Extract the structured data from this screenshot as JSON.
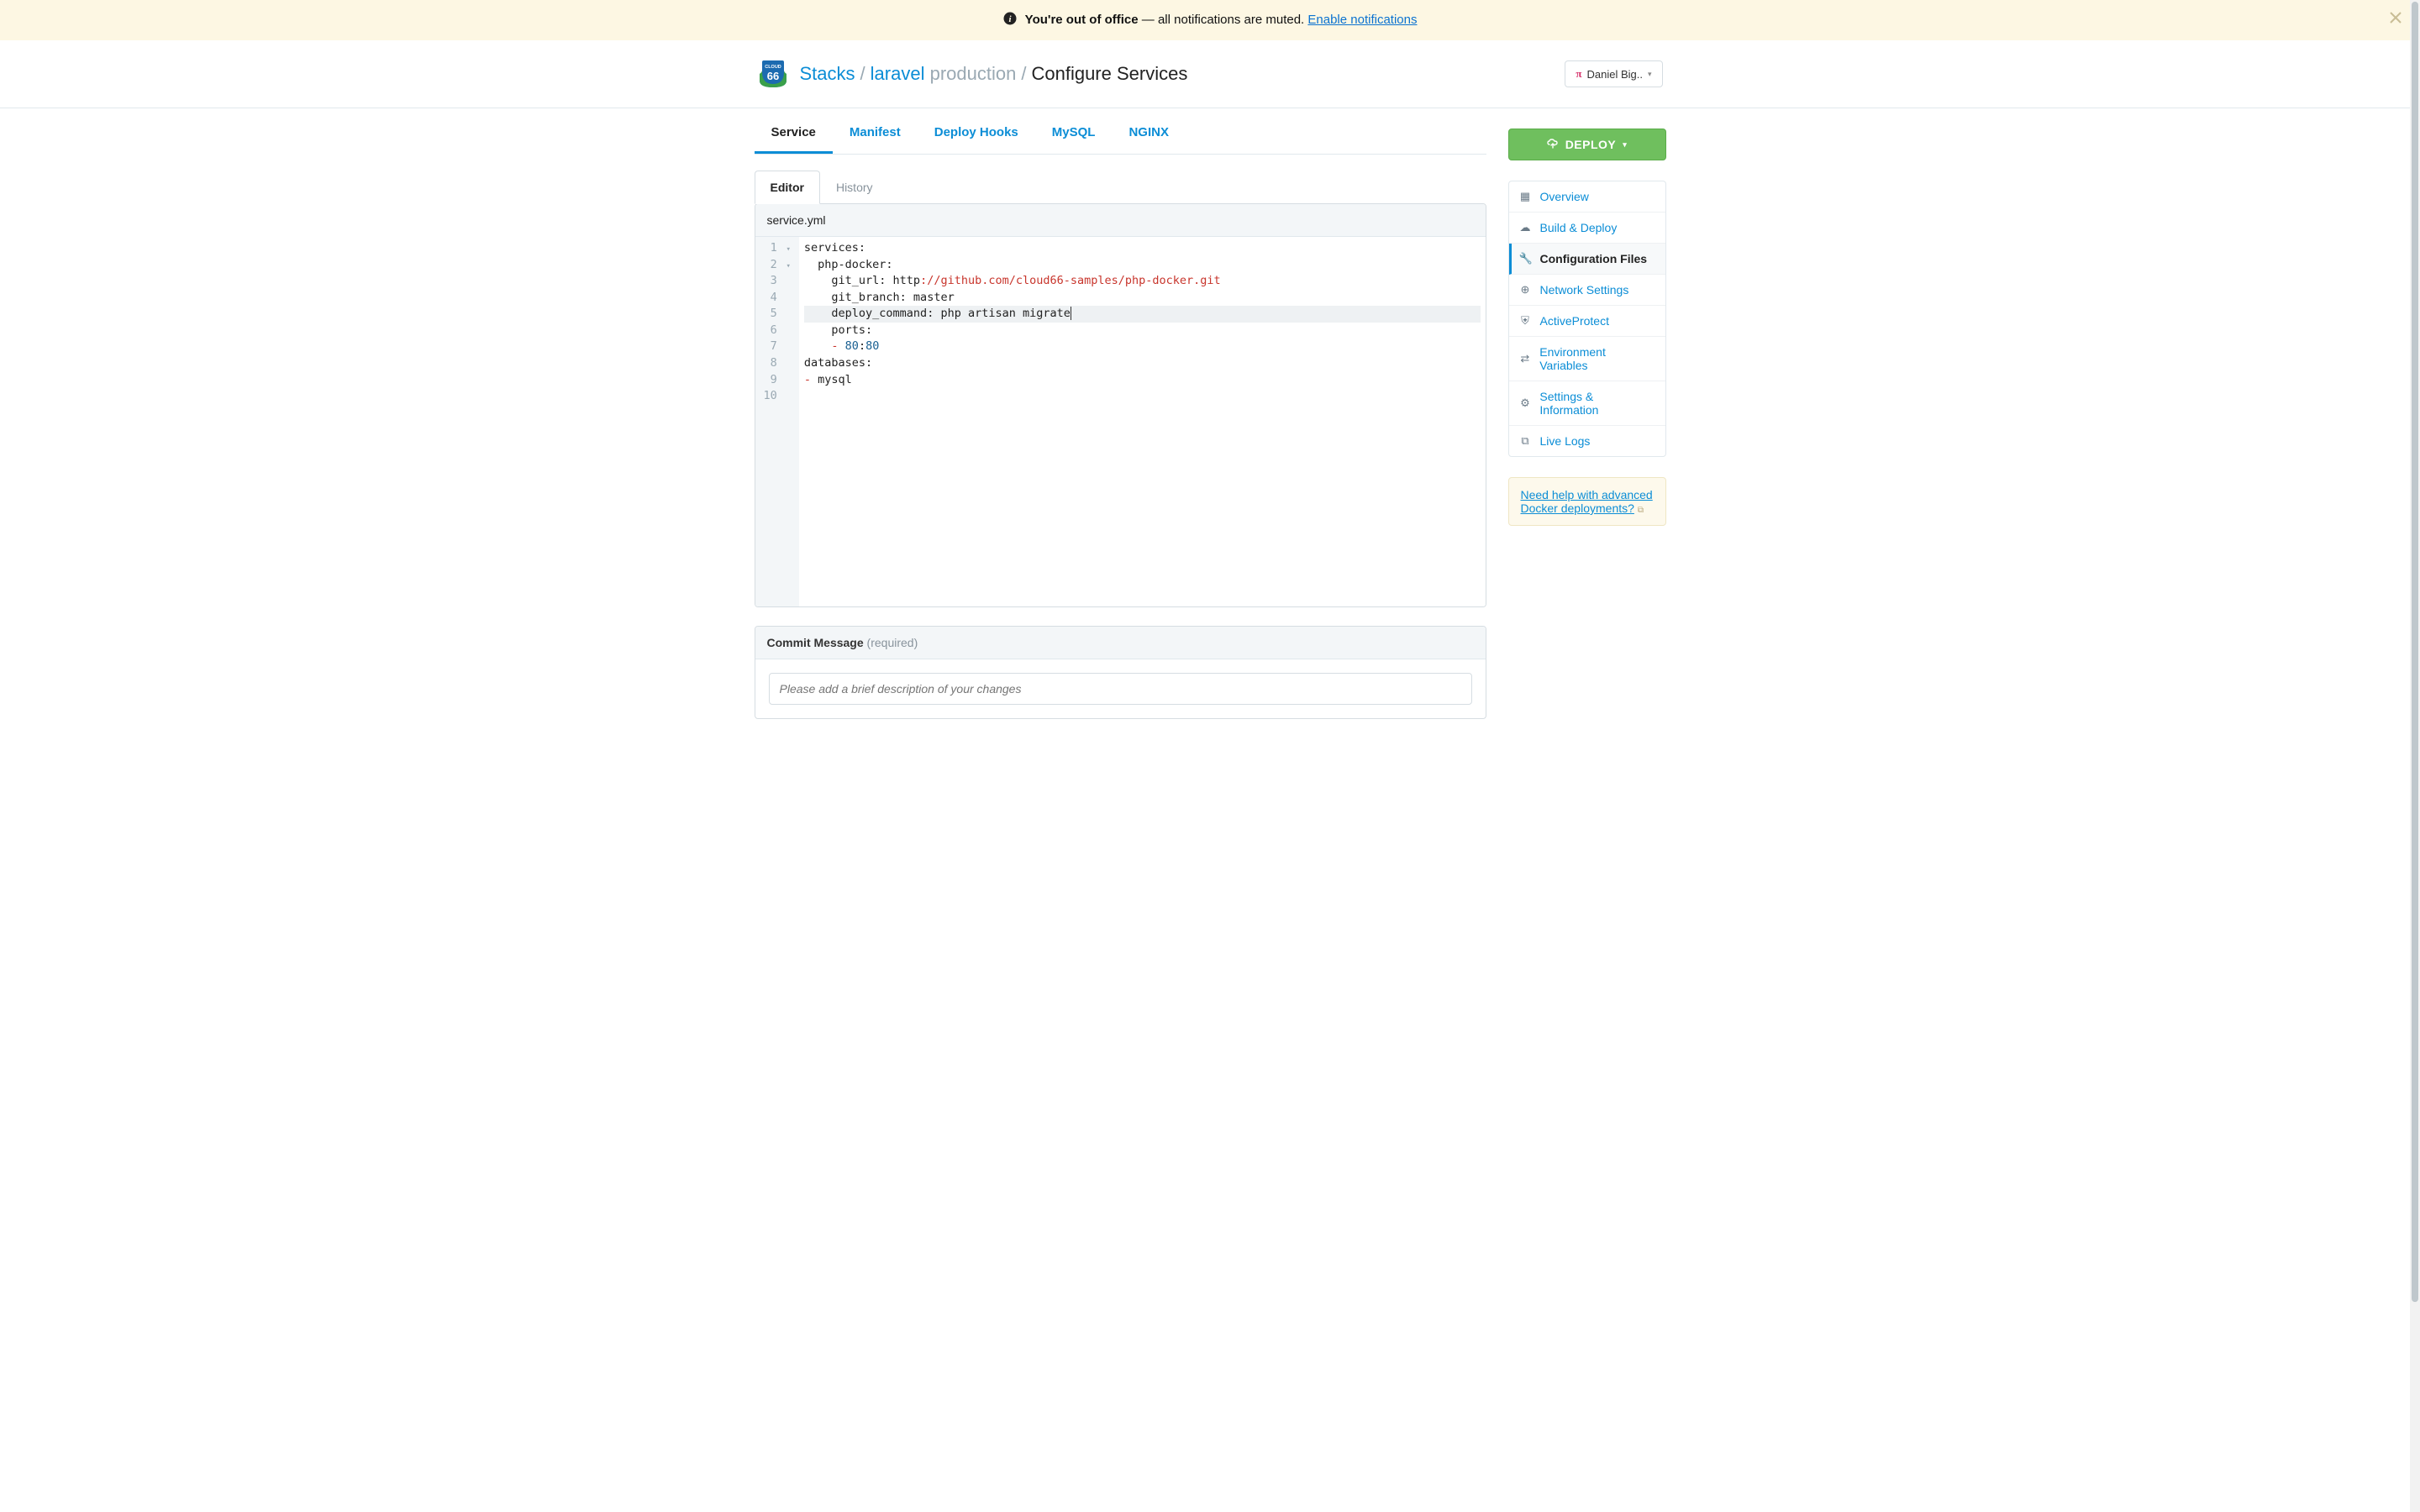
{
  "banner": {
    "text_prefix": "You're out of office",
    "text_rest": " — all notifications are muted. ",
    "link": "Enable notifications"
  },
  "breadcrumb": {
    "stacks": "Stacks",
    "app": "laravel",
    "env": "production",
    "current": "Configure Services"
  },
  "user_menu": {
    "label": "Daniel Big.."
  },
  "file_tabs": [
    {
      "label": "Service",
      "active": true
    },
    {
      "label": "Manifest",
      "active": false
    },
    {
      "label": "Deploy Hooks",
      "active": false
    },
    {
      "label": "MySQL",
      "active": false
    },
    {
      "label": "NGINX",
      "active": false
    }
  ],
  "sub_tabs": [
    {
      "label": "Editor",
      "active": true
    },
    {
      "label": "History",
      "active": false
    }
  ],
  "editor": {
    "filename": "service.yml",
    "line_count": 10,
    "highlighted_line": 5,
    "fold_lines": [
      1,
      2
    ],
    "code": {
      "l1": "services:",
      "l2_indent": "  ",
      "l2": "php-docker:",
      "l3_indent": "    ",
      "l3_key": "git_url: ",
      "l3_http": "http",
      "l3_rest": "://github.com/cloud66-samples/php-docker.git",
      "l4_indent": "    ",
      "l4": "git_branch: master",
      "l5_indent": "    ",
      "l5": "deploy_command: php artisan migrate",
      "l6_indent": "    ",
      "l6": "ports:",
      "l7_indent": "    ",
      "l7_dash": "- ",
      "l7_a": "80",
      "l7_colon": ":",
      "l7_b": "80",
      "l8": "databases:",
      "l9_dash": "- ",
      "l9": "mysql"
    }
  },
  "commit": {
    "title": "Commit Message",
    "required": "(required)",
    "placeholder": "Please add a brief description of your changes"
  },
  "deploy_button": "DEPLOY",
  "side_nav": [
    {
      "icon": "grid",
      "label": "Overview",
      "active": false
    },
    {
      "icon": "ship",
      "label": "Build & Deploy",
      "active": false
    },
    {
      "icon": "wrench",
      "label": "Configuration Files",
      "active": true
    },
    {
      "icon": "globe",
      "label": "Network Settings",
      "active": false
    },
    {
      "icon": "shield",
      "label": "ActiveProtect",
      "active": false
    },
    {
      "icon": "swap",
      "label": "Environment Variables",
      "active": false
    },
    {
      "icon": "gear",
      "label": "Settings & Information",
      "active": false
    },
    {
      "icon": "copy",
      "label": "Live Logs",
      "active": false
    }
  ],
  "help": {
    "line1": "Need help with advanced",
    "line2": "Docker deployments?"
  },
  "icons": {
    "grid": "▦",
    "ship": "☁",
    "wrench": "🔧",
    "globe": "⊕",
    "shield": "⛨",
    "swap": "⇄",
    "gear": "⚙",
    "copy": "⧉",
    "info": "ⓘ",
    "close": "✕",
    "caret": "▾",
    "ext": "⧉",
    "deploy": "☁"
  }
}
